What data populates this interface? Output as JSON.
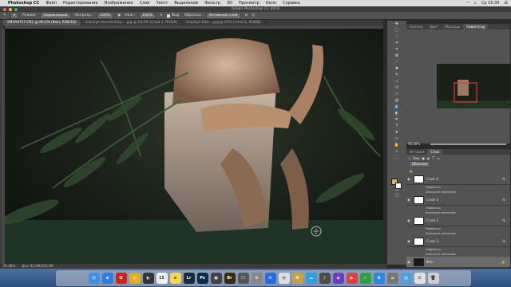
{
  "menubar": {
    "app": "Photoshop CC",
    "items": [
      "Файл",
      "Редактирование",
      "Изображение",
      "Слои",
      "Текст",
      "Выделение",
      "Фильтр",
      "3D",
      "Просмотр",
      "Окно",
      "Справка"
    ],
    "clock": "Ср 15:35"
  },
  "window": {
    "title": "Adobe Photoshop CC 2018"
  },
  "options": {
    "mode_label": "Режим:",
    "mode_value": "Нормальный",
    "opacity_label": "Непрозр.:",
    "opacity_value": "100%",
    "flow_label": "Наж.:",
    "flow_value": "100%",
    "align_label": "Выр.",
    "sample_label": "Образец:",
    "sample_value": "Активный слой"
  },
  "tabs": [
    {
      "label": "5M1A9717.CR2 @ 90,5% (Фон, RGB/16)",
      "active": true
    },
    {
      "label": "krasivye-zhenshchiny-…jpg @ 13,3% (Слой 1, RGB/8)",
      "active": false
    },
    {
      "label": "krasivye-foto-…jpg @ 25% (Слой 1, RGB/8)",
      "active": false
    }
  ],
  "statusbar": {
    "zoom": "90,48%",
    "doc": "Док: 81,6M/163,3M"
  },
  "colors": {
    "foreground": "#e8a96a",
    "background": "#ffffff",
    "nav_box": "#e03a2a"
  },
  "navigator": {
    "tabs": [
      "Каналы",
      "Цвет",
      "Образцы",
      "Навигатор"
    ],
    "zoom": "90,48%"
  },
  "layers": {
    "tabs": [
      "История",
      "Слои"
    ],
    "kind_label": "Вид",
    "blend": "Обычные",
    "items": [
      {
        "name": "Слой 4",
        "effects": "Эффекты",
        "sub": "Внешнее свечение",
        "fx": "fx"
      },
      {
        "name": "Слой 3",
        "effects": "Эффекты",
        "sub": "Внешнее свечение",
        "fx": "fx"
      },
      {
        "name": "Слой 2",
        "effects": "Эффекты",
        "sub": "Внешнее свечение",
        "fx": "fx"
      },
      {
        "name": "Слой 1",
        "effects": "Эффекты",
        "sub": "Внешнее свечение",
        "fx": "fx"
      },
      {
        "name": "Фон",
        "dark": true
      }
    ]
  },
  "dock": [
    {
      "icon": "finder-icon",
      "color": "#3b8fe6",
      "glyph": "☺"
    },
    {
      "icon": "safari-icon",
      "color": "#2f7be5",
      "glyph": "⊕"
    },
    {
      "icon": "opera-icon",
      "color": "#d02020",
      "glyph": "O"
    },
    {
      "icon": "chrome-icon",
      "color": "#e0b020",
      "glyph": "◎"
    },
    {
      "icon": "app-icon",
      "color": "#333",
      "glyph": "◐"
    },
    {
      "icon": "calendar-icon",
      "color": "#f0f0f0",
      "glyph": "15"
    },
    {
      "icon": "notes-icon",
      "color": "#f5d84a",
      "glyph": "≡"
    },
    {
      "icon": "lightroom-icon",
      "color": "#1a2a3a",
      "glyph": "Lr"
    },
    {
      "icon": "photoshop-icon",
      "color": "#0c2a4a",
      "glyph": "Ps"
    },
    {
      "icon": "app-icon",
      "color": "#444",
      "glyph": "▣"
    },
    {
      "icon": "bridge-icon",
      "color": "#3a2a10",
      "glyph": "Br"
    },
    {
      "icon": "app-icon",
      "color": "#555",
      "glyph": "☐"
    },
    {
      "icon": "app-icon",
      "color": "#888",
      "glyph": "⚙"
    },
    {
      "icon": "app-icon",
      "color": "#2a6adf",
      "glyph": "✉"
    },
    {
      "icon": "app-icon",
      "color": "#dedede",
      "glyph": "◔"
    },
    {
      "icon": "app-icon",
      "color": "#c8a040",
      "glyph": "⌘"
    },
    {
      "icon": "app-icon",
      "color": "#2aa0e0",
      "glyph": "☁"
    },
    {
      "icon": "app-icon",
      "color": "#4a4a4a",
      "glyph": "♪"
    },
    {
      "icon": "app-icon",
      "color": "#6a40c0",
      "glyph": "◈"
    },
    {
      "icon": "app-icon",
      "color": "#e04040",
      "glyph": "▶"
    },
    {
      "icon": "app-icon",
      "color": "#30a040",
      "glyph": "✓"
    },
    {
      "icon": "app-icon",
      "color": "#2a8adf",
      "glyph": "A"
    },
    {
      "icon": "app-icon",
      "color": "#777",
      "glyph": "⌂"
    },
    {
      "icon": "folder-icon",
      "color": "#4aa0e0",
      "glyph": "▤"
    },
    {
      "icon": "app-icon",
      "color": "#e0e0e0",
      "glyph": "☰"
    },
    {
      "icon": "trash-icon",
      "color": "#cfcfcf",
      "glyph": "🗑"
    }
  ]
}
